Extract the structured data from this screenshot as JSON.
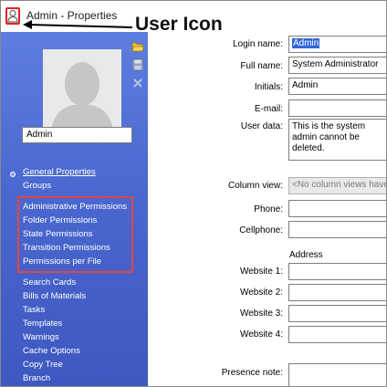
{
  "window": {
    "title": "Admin - Properties",
    "annotation": "User Icon"
  },
  "sidebar": {
    "user_name": "Admin",
    "nav": [
      {
        "label": "General Properties"
      },
      {
        "label": "Groups"
      },
      {
        "label": "Administrative Permissions"
      },
      {
        "label": "Folder Permissions"
      },
      {
        "label": "State Permissions"
      },
      {
        "label": "Transition Permissions"
      },
      {
        "label": "Permissions per File"
      },
      {
        "label": "Search Cards"
      },
      {
        "label": "Bills of Materials"
      },
      {
        "label": "Tasks"
      },
      {
        "label": "Templates"
      },
      {
        "label": "Warnings"
      },
      {
        "label": "Cache Options"
      },
      {
        "label": "Copy Tree"
      },
      {
        "label": "Branch"
      }
    ]
  },
  "form": {
    "login_name": {
      "label": "Login name:",
      "value": "Admin"
    },
    "full_name": {
      "label": "Full name:",
      "value": "System Administrator"
    },
    "initials": {
      "label": "Initials:",
      "value": "Admin"
    },
    "email": {
      "label": "E-mail:",
      "value": ""
    },
    "user_data": {
      "label": "User data:",
      "value": "This is the system admin cannot be deleted."
    },
    "column_view": {
      "label": "Column view:",
      "value": "<No column views have b"
    },
    "phone": {
      "label": "Phone:",
      "value": ""
    },
    "cellphone": {
      "label": "Cellphone:",
      "value": ""
    },
    "address_heading": "Address",
    "website1": {
      "label": "Website 1:",
      "value": ""
    },
    "website2": {
      "label": "Website 2:",
      "value": ""
    },
    "website3": {
      "label": "Website 3:",
      "value": ""
    },
    "website4": {
      "label": "Website 4:",
      "value": ""
    },
    "presence_note": {
      "label": "Presence note:",
      "value": ""
    }
  },
  "icons": {
    "user": "user-icon",
    "folder_open": "folder-open-icon",
    "save": "save-icon",
    "delete": "delete-icon"
  },
  "colors": {
    "highlight": "#e44444",
    "sidebar": "#4a68d0",
    "selection": "#3267d6"
  }
}
